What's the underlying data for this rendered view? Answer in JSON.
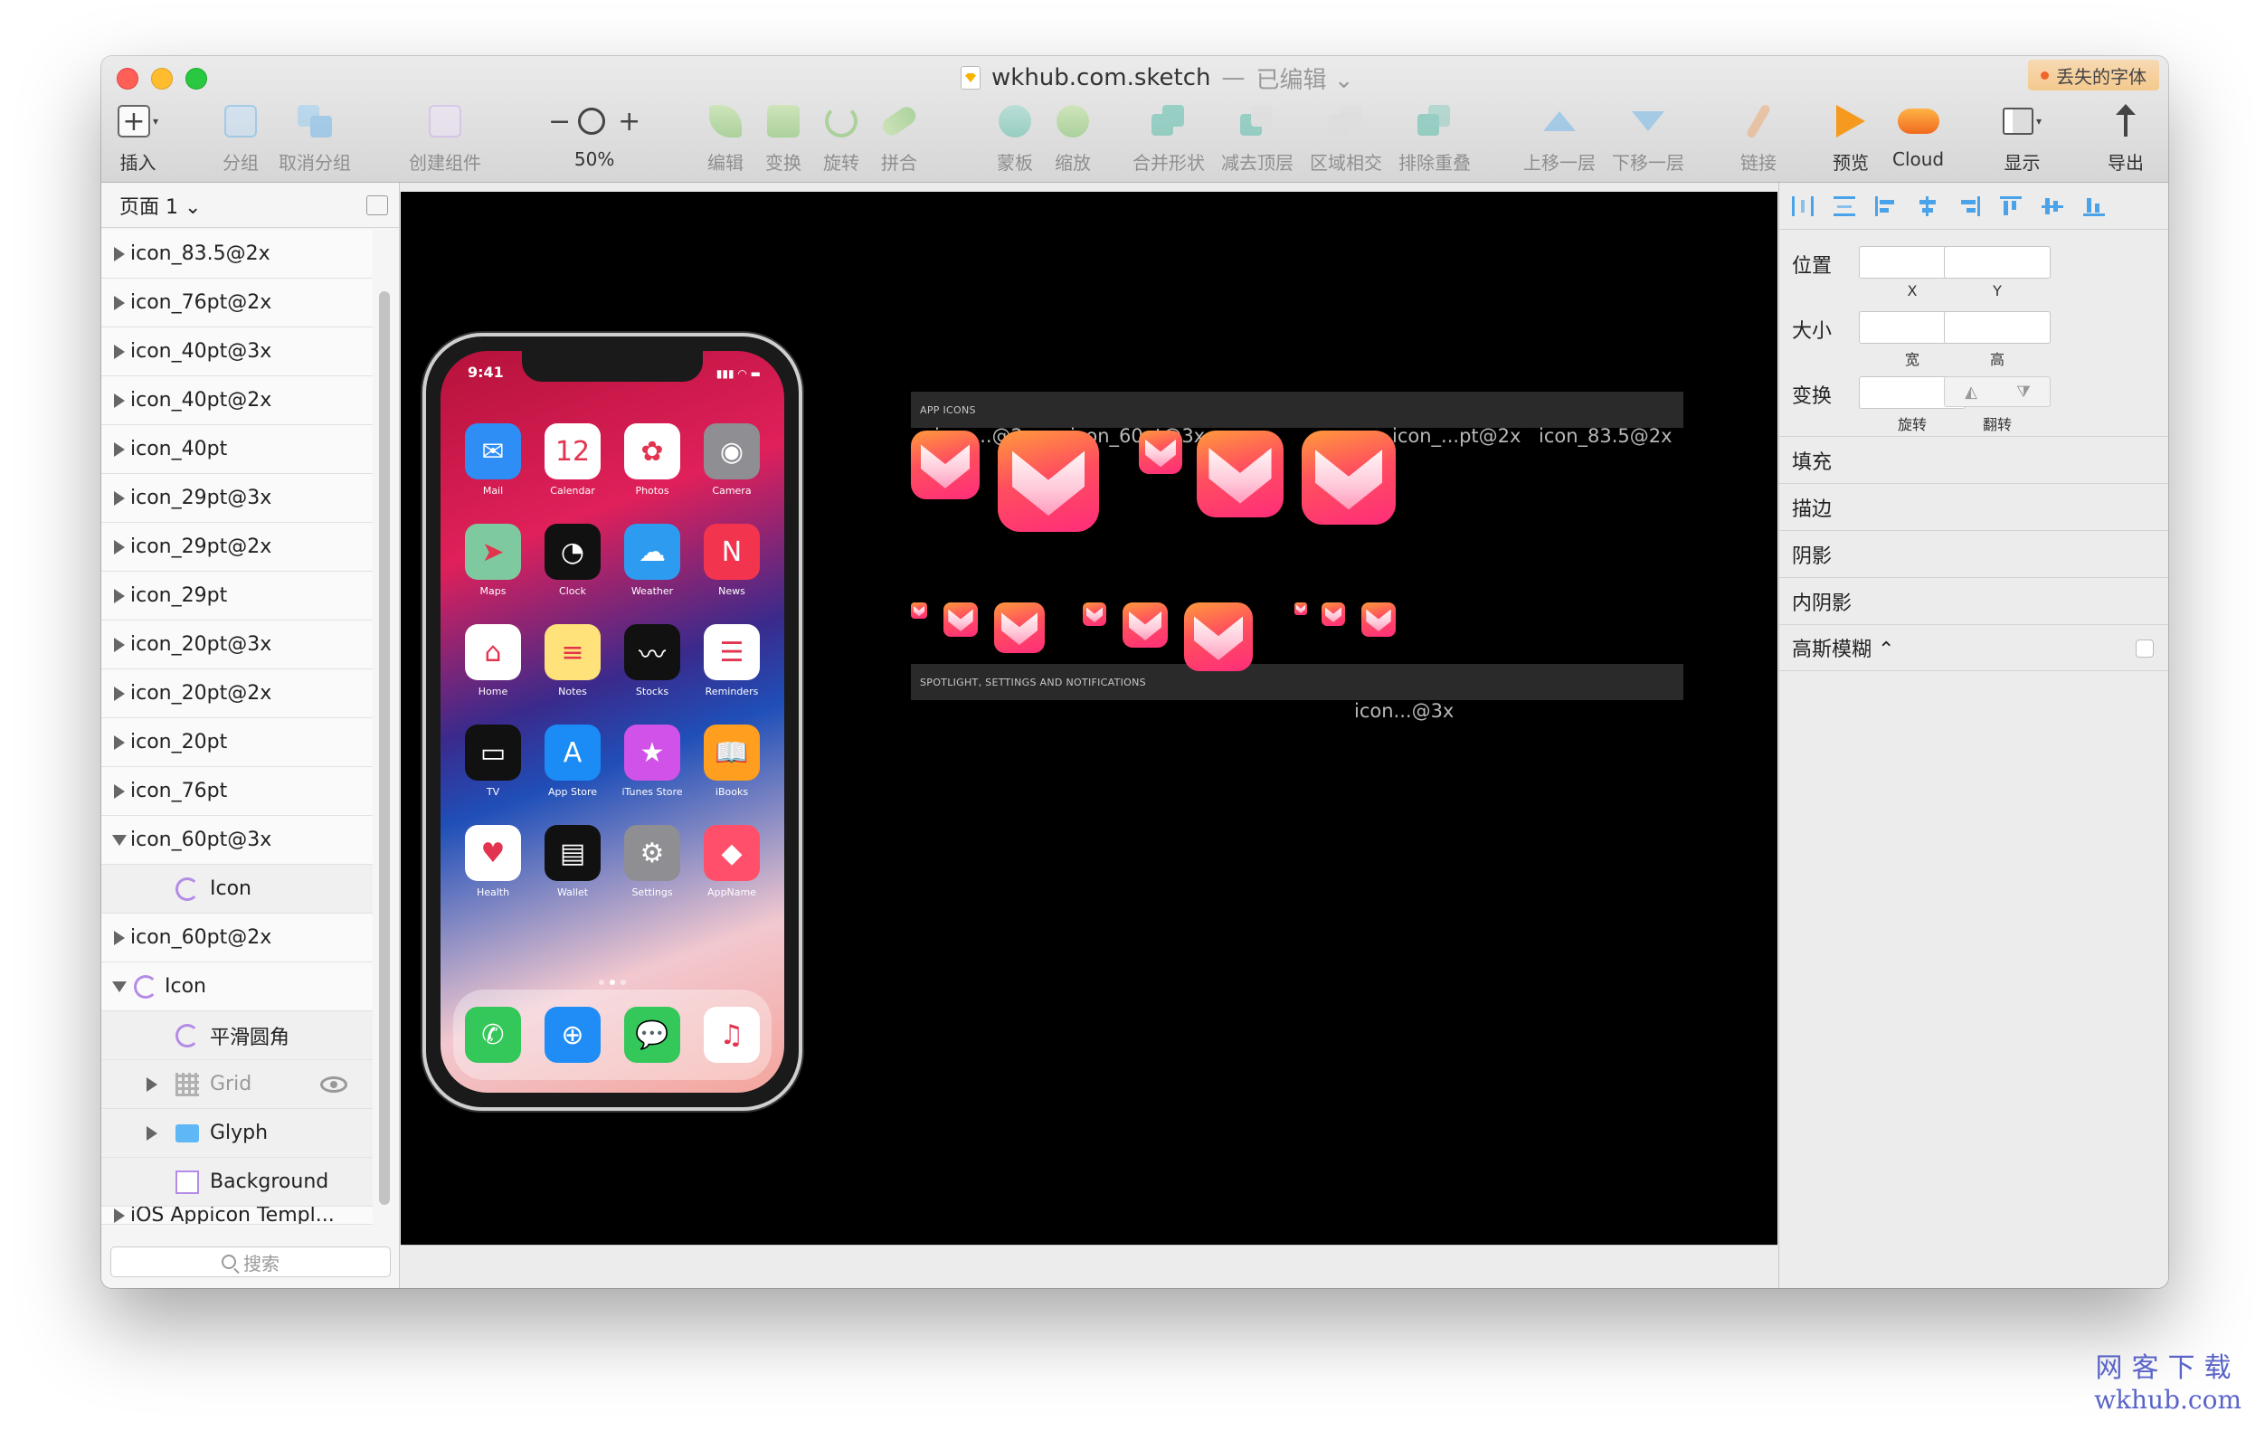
{
  "window": {
    "title": "wkhub.com.sketch",
    "title_sep": "—",
    "edited": "已编辑 ⌄",
    "missing_font": "丢失的字体"
  },
  "toolbar": [
    {
      "id": "insert",
      "label": "插入"
    },
    {
      "id": "group",
      "label": "分组"
    },
    {
      "id": "ungroup",
      "label": "取消分组"
    },
    {
      "id": "create-symbol",
      "label": "创建组件"
    },
    {
      "id": "zoom",
      "label": "50%",
      "minus": "−",
      "plus": "+"
    },
    {
      "id": "edit",
      "label": "编辑"
    },
    {
      "id": "transform",
      "label": "变换"
    },
    {
      "id": "rotate",
      "label": "旋转"
    },
    {
      "id": "flatten",
      "label": "拼合"
    },
    {
      "id": "mask",
      "label": "蒙板"
    },
    {
      "id": "scale",
      "label": "缩放"
    },
    {
      "id": "union",
      "label": "合并形状"
    },
    {
      "id": "subtract",
      "label": "减去顶层"
    },
    {
      "id": "intersect",
      "label": "区域相交"
    },
    {
      "id": "difference",
      "label": "排除重叠"
    },
    {
      "id": "forward",
      "label": "上移一层"
    },
    {
      "id": "backward",
      "label": "下移一层"
    },
    {
      "id": "link",
      "label": "链接"
    },
    {
      "id": "preview",
      "label": "预览"
    },
    {
      "id": "cloud",
      "label": "Cloud"
    },
    {
      "id": "view",
      "label": "显示"
    },
    {
      "id": "export",
      "label": "导出"
    }
  ],
  "sidebar": {
    "page": "页面 1 ⌄",
    "search_placeholder": "搜索",
    "layers": [
      {
        "label": "icon_83.5@2x",
        "type": "artboard",
        "expanded": false
      },
      {
        "label": "icon_76pt@2x",
        "type": "artboard",
        "expanded": false
      },
      {
        "label": "icon_40pt@3x",
        "type": "artboard",
        "expanded": false
      },
      {
        "label": "icon_40pt@2x",
        "type": "artboard",
        "expanded": false
      },
      {
        "label": "icon_40pt",
        "type": "artboard",
        "expanded": false
      },
      {
        "label": "icon_29pt@3x",
        "type": "artboard",
        "expanded": false
      },
      {
        "label": "icon_29pt@2x",
        "type": "artboard",
        "expanded": false
      },
      {
        "label": "icon_29pt",
        "type": "artboard",
        "expanded": false
      },
      {
        "label": "icon_20pt@3x",
        "type": "artboard",
        "expanded": false
      },
      {
        "label": "icon_20pt@2x",
        "type": "artboard",
        "expanded": false
      },
      {
        "label": "icon_20pt",
        "type": "artboard",
        "expanded": false
      },
      {
        "label": "icon_76pt",
        "type": "artboard",
        "expanded": false
      },
      {
        "label": "icon_60pt@3x",
        "type": "artboard",
        "expanded": true
      },
      {
        "label": "Icon",
        "type": "symbol-child"
      },
      {
        "label": "icon_60pt@2x",
        "type": "artboard",
        "expanded": false
      },
      {
        "label": "Icon",
        "type": "symbol",
        "expanded": true
      },
      {
        "label": "平滑圆角",
        "type": "symbol-child"
      },
      {
        "label": "Grid",
        "type": "grid"
      },
      {
        "label": "Glyph",
        "type": "folder"
      },
      {
        "label": "Background",
        "type": "rect"
      },
      {
        "label": "iOS Appicon Templ...",
        "type": "cut"
      }
    ]
  },
  "phone": {
    "time": "9:41",
    "status_right": "▮▮▮ ◠ ▬",
    "apps": [
      {
        "name": "Mail",
        "glyph": "✉",
        "color": "#2f8ef5"
      },
      {
        "name": "Calendar",
        "glyph": "12",
        "color": "#ffffff"
      },
      {
        "name": "Photos",
        "glyph": "✿",
        "color": "#ffffff"
      },
      {
        "name": "Camera",
        "glyph": "◉",
        "color": "#8e8e93"
      },
      {
        "name": "Maps",
        "glyph": "➤",
        "color": "#7ec9a0"
      },
      {
        "name": "Clock",
        "glyph": "◔",
        "color": "#111111"
      },
      {
        "name": "Weather",
        "glyph": "☁",
        "color": "#2d9cf0"
      },
      {
        "name": "News",
        "glyph": "N",
        "color": "#f2344f"
      },
      {
        "name": "Home",
        "glyph": "⌂",
        "color": "#ffffff"
      },
      {
        "name": "Notes",
        "glyph": "≡",
        "color": "#ffe27a"
      },
      {
        "name": "Stocks",
        "glyph": "〰",
        "color": "#111111"
      },
      {
        "name": "Reminders",
        "glyph": "☰",
        "color": "#ffffff"
      },
      {
        "name": "TV",
        "glyph": "▭",
        "color": "#111111"
      },
      {
        "name": "App Store",
        "glyph": "A",
        "color": "#1b8cf5"
      },
      {
        "name": "iTunes Store",
        "glyph": "★",
        "color": "#d152e8"
      },
      {
        "name": "iBooks",
        "glyph": "📖",
        "color": "#ff9e1f"
      },
      {
        "name": "Health",
        "glyph": "♥",
        "color": "#ffffff"
      },
      {
        "name": "Wallet",
        "glyph": "▤",
        "color": "#111111"
      },
      {
        "name": "Settings",
        "glyph": "⚙",
        "color": "#8e8e93"
      },
      {
        "name": "AppName",
        "glyph": "◆",
        "color": "#ff4f6a"
      }
    ],
    "dock": [
      {
        "name": "Phone",
        "glyph": "✆",
        "color": "#34c759"
      },
      {
        "name": "Safari",
        "glyph": "⊕",
        "color": "#1f8df5"
      },
      {
        "name": "Messages",
        "glyph": "💬",
        "color": "#34c759"
      },
      {
        "name": "Music",
        "glyph": "♫",
        "color": "#ffffff"
      }
    ]
  },
  "artboards": {
    "section1": "APP ICONS",
    "section2": "SPOTLIGHT, SETTINGS AND NOTIFICATIONS",
    "labels": {
      "a": "icon...@2x",
      "b": "icon_60pt@3x",
      "c": "icon_...pt@2x",
      "d": "icon_83.5@2x",
      "e": "icon...@3x"
    }
  },
  "inspector": {
    "position": "位置",
    "size": "大小",
    "transform": "变换",
    "x": "X",
    "y": "Y",
    "width": "宽",
    "height": "高",
    "rotate": "旋转",
    "flip": "翻转",
    "fill": "填充",
    "border": "描边",
    "shadow": "阴影",
    "inner_shadow": "内阴影",
    "blur": "高斯模糊 ⌃"
  },
  "watermark": {
    "line1": "网客下载",
    "line2": "wkhub.com"
  }
}
